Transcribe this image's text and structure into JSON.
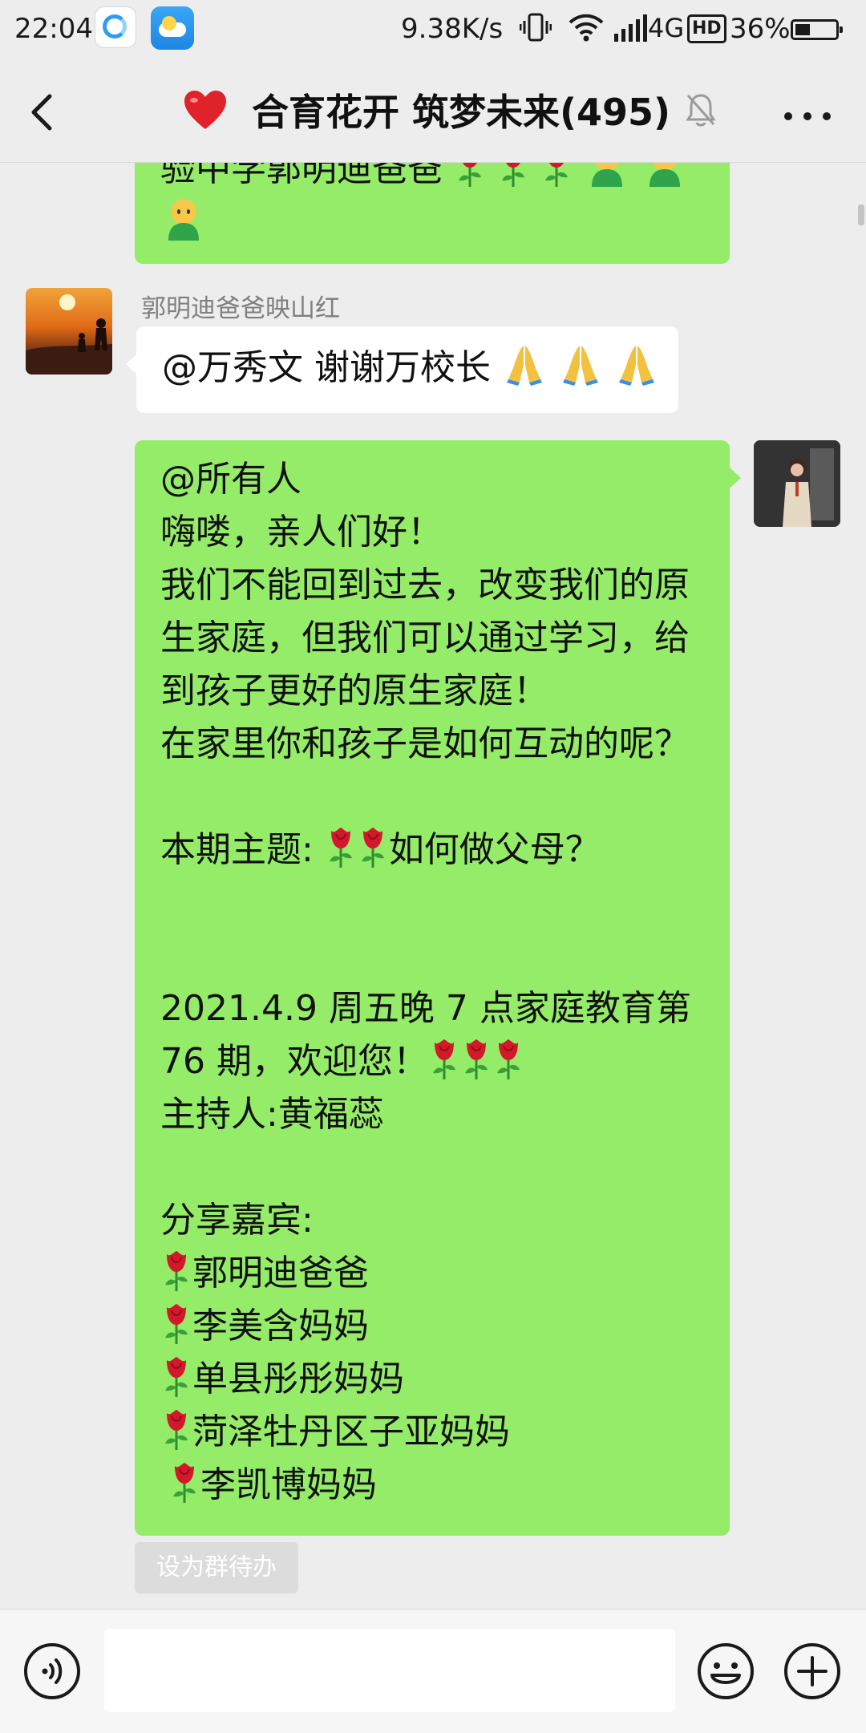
{
  "status_bar": {
    "time": "22:04",
    "net_speed": "9.38K/s",
    "network": "4G",
    "hd": "HD",
    "battery": "36%"
  },
  "header": {
    "title": "合育花开 筑梦未来(495)"
  },
  "messages": {
    "previous_tail_text": "验中学郭明迪爸爸",
    "reply": {
      "sender": "郭明迪爸爸映山红",
      "text": "@万秀文  谢谢万校长"
    },
    "announcement": {
      "line1": "@所有人",
      "line2": "嗨喽，亲人们好！",
      "line3": "我们不能回到过去，改变我们的原",
      "line4": "生家庭，但我们可以通过学习，给",
      "line5": "到孩子更好的原生家庭！",
      "line6": "在家里你和孩子是如何互动的呢？",
      "topic_prefix": "本期主题: ",
      "topic_suffix": "如何做父母？",
      "date_line1": "2021.4.9 周五晚 7 点家庭教育第",
      "date_line2": "76 期，欢迎您！",
      "host": "主持人:黄福蕊",
      "guests_label": "分享嘉宾:",
      "guests": [
        "郭明迪爸爸",
        "李美含妈妈",
        "单县彤彤妈妈",
        "菏泽牡丹区子亚妈妈",
        "李凯博妈妈"
      ]
    },
    "todo_button": "设为群待办"
  },
  "input_bar": {
    "placeholder": ""
  },
  "colors": {
    "self_bubble": "#95ec69",
    "other_bubble": "#ffffff",
    "background": "#ededed"
  }
}
